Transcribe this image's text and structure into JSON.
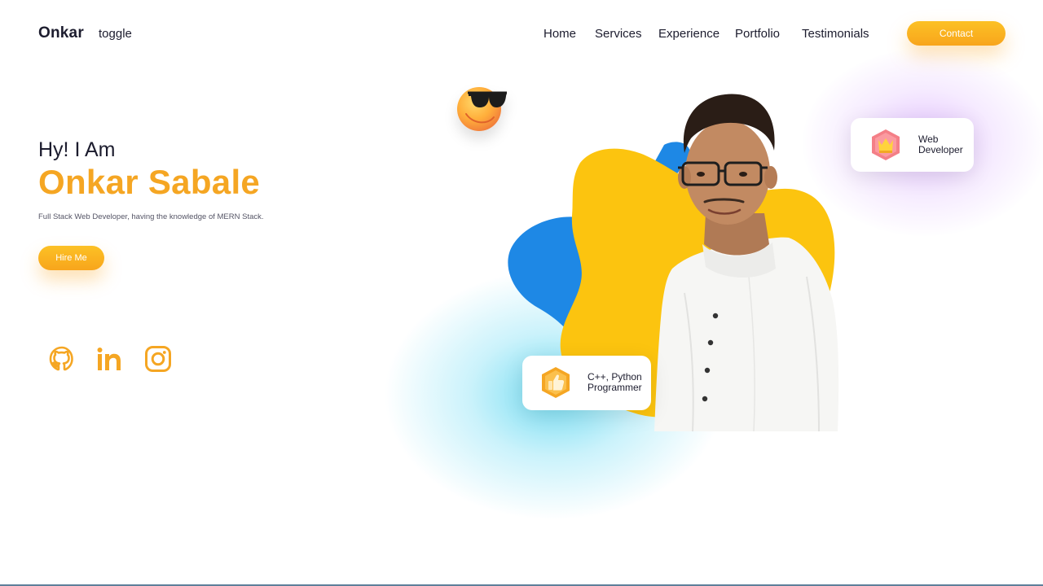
{
  "header": {
    "logo": "Onkar",
    "toggle_label": "toggle",
    "nav": [
      "Home",
      "Services",
      "Experience",
      "Portfolio",
      "Testimonials"
    ],
    "contact_label": "Contact"
  },
  "hero": {
    "greeting": "Hy! I Am",
    "name": "Onkar Sabale",
    "description": "Full Stack Web Developer, having the knowledge of MERN Stack.",
    "hire_label": "Hire Me"
  },
  "social": [
    {
      "icon": "github-icon"
    },
    {
      "icon": "linkedin-icon"
    },
    {
      "icon": "instagram-icon"
    }
  ],
  "cards": {
    "web": {
      "icon": "crown-icon",
      "line1": "Web",
      "line2": "Developer"
    },
    "programmer": {
      "icon": "thumbs-up-icon",
      "line1": "C++, Python",
      "line2": "Programmer"
    }
  },
  "colors": {
    "accent": "#f5a623",
    "button_gradient_top": "#fcc125",
    "button_gradient_bottom": "#f8a51c",
    "blob_blue": "#1e88e5",
    "blob_yellow": "#fcc40f",
    "text_dark": "#1c1c2e"
  }
}
